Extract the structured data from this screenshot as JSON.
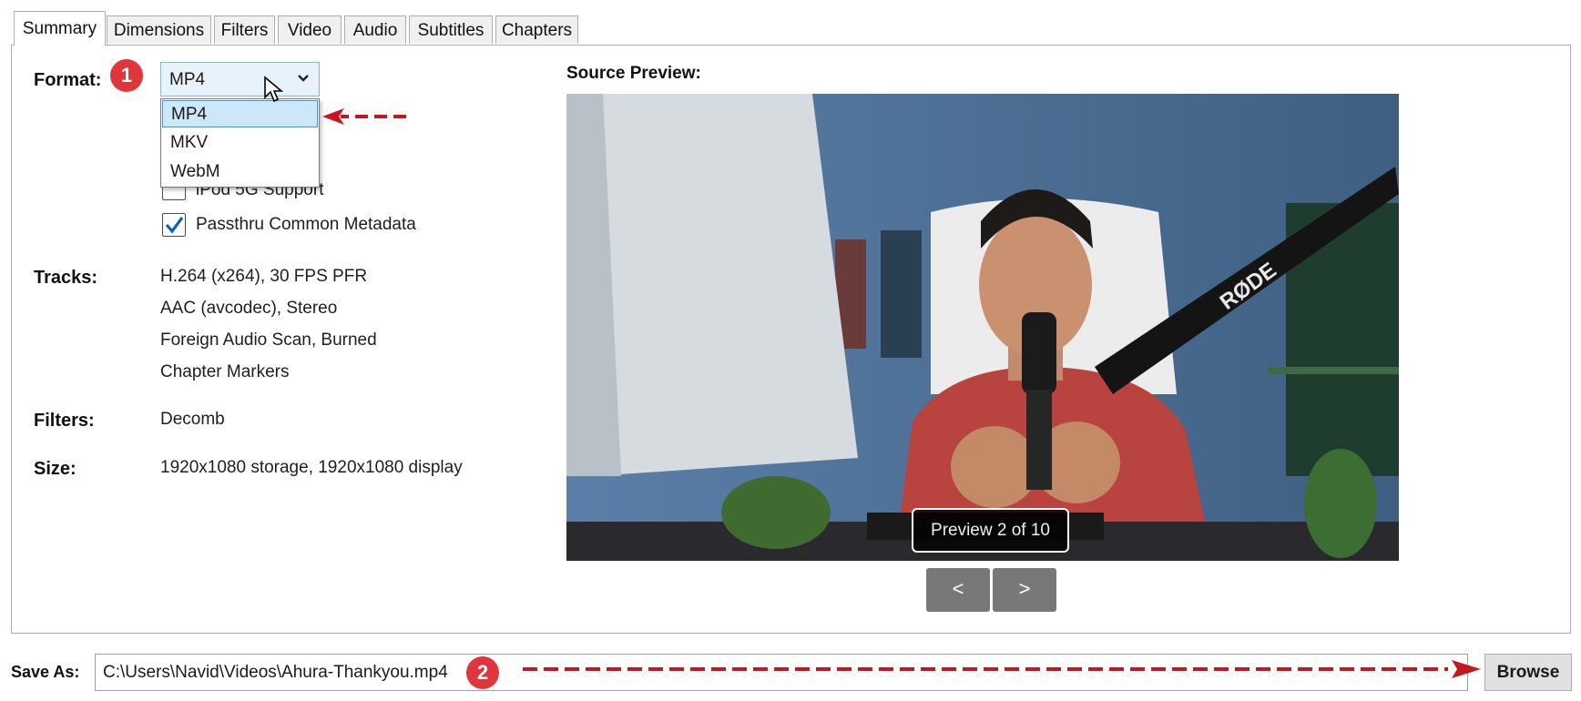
{
  "tabs": [
    "Summary",
    "Dimensions",
    "Filters",
    "Video",
    "Audio",
    "Subtitles",
    "Chapters"
  ],
  "format": {
    "label": "Format:",
    "selected": "MP4",
    "options": [
      "MP4",
      "MKV",
      "WebM"
    ],
    "badge": "1"
  },
  "checkboxes": [
    {
      "label": "iPod 5G Support",
      "checked": false
    },
    {
      "label": "Passthru Common Metadata",
      "checked": true
    }
  ],
  "tracks": {
    "label": "Tracks:",
    "items": [
      "H.264 (x264), 30 FPS PFR",
      "AAC (avcodec), Stereo",
      "Foreign Audio Scan, Burned",
      "Chapter Markers"
    ]
  },
  "filters": {
    "label": "Filters:",
    "value": "Decomb"
  },
  "size": {
    "label": "Size:",
    "value": "1920x1080 storage, 1920x1080 display"
  },
  "preview": {
    "heading": "Source Preview:",
    "overlay": "Preview 2 of 10",
    "prev_label": "<",
    "next_label": ">",
    "mic_brand": "RØDE"
  },
  "save": {
    "label": "Save As:",
    "path": "C:\\Users\\Navid\\Videos\\Ahura-Thankyou.mp4",
    "badge": "2",
    "browse_label": "Browse"
  },
  "colors": {
    "annotation": "#e0353b",
    "arrow": "#c6161f",
    "selection": "#cce8f8"
  }
}
